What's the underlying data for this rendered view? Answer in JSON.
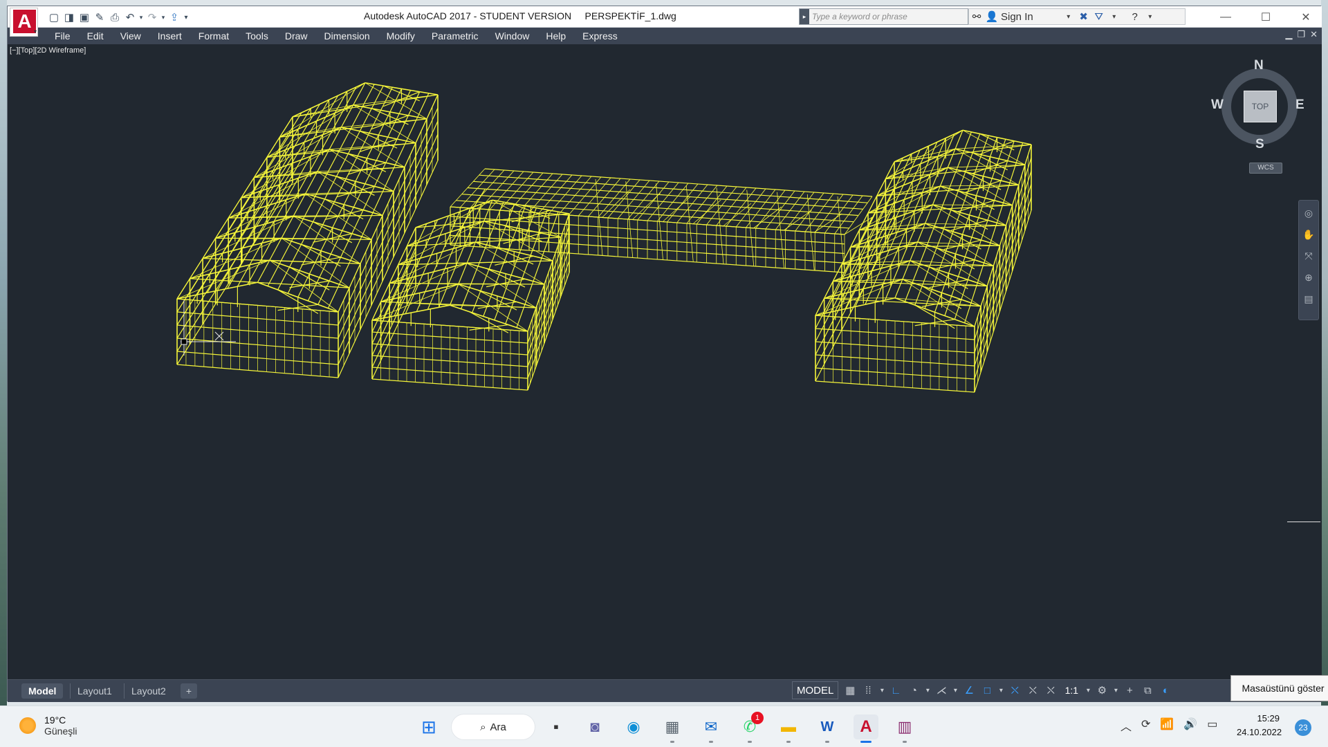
{
  "window": {
    "title": "Autodesk AutoCAD 2017 - STUDENT VERSION     PERSPEKTİF_1.dwg",
    "search_placeholder": "Type a keyword or phrase",
    "signin_label": "Sign In"
  },
  "menu": [
    "File",
    "Edit",
    "View",
    "Insert",
    "Format",
    "Tools",
    "Draw",
    "Dimension",
    "Modify",
    "Parametric",
    "Window",
    "Help",
    "Express"
  ],
  "viewport": {
    "label": "[−][Top][2D Wireframe]",
    "viewcube_face": "TOP",
    "compass": {
      "n": "N",
      "s": "S",
      "e": "E",
      "w": "W"
    },
    "wcs": "WCS",
    "drawing_color": "#f5f53a"
  },
  "layout_tabs": [
    "Model",
    "Layout1",
    "Layout2",
    "+"
  ],
  "status": {
    "model": "MODEL",
    "scale": "1:1"
  },
  "tooltip": "Masaüstünü göster",
  "taskbar": {
    "weather_temp": "19°C",
    "weather_condition": "Güneşli",
    "search_label": "Ara",
    "whatsapp_badge": "1",
    "time": "15:29",
    "date": "24.10.2022",
    "notifications": "23"
  },
  "icons": {
    "app_logo": "autocad-a-icon",
    "taskbar": [
      "windows-start-icon",
      "search-icon",
      "task-view-icon",
      "teams-chat-icon",
      "edge-icon",
      "calculator-icon",
      "outlook-icon",
      "whatsapp-icon",
      "file-explorer-icon",
      "word-icon",
      "autocad-icon",
      "winrar-icon"
    ]
  }
}
